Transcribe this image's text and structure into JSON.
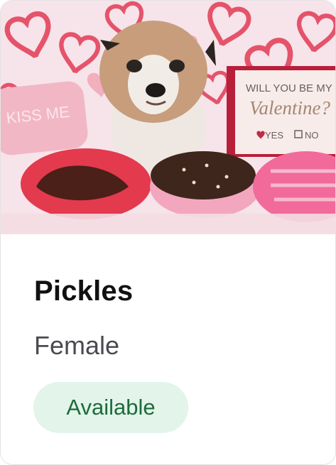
{
  "pet": {
    "name": "Pickles",
    "gender": "Female",
    "status": "Available"
  },
  "photo": {
    "sign_line1": "WILL YOU BE MY",
    "sign_line2": "Valentine?",
    "sign_yes": "YES",
    "sign_no": "NO",
    "pillow_text": "KISS ME"
  },
  "colors": {
    "status_bg": "#e3f4ea",
    "status_text": "#1d6b3c",
    "name_text": "#111111",
    "gender_text": "#4a4a52"
  }
}
